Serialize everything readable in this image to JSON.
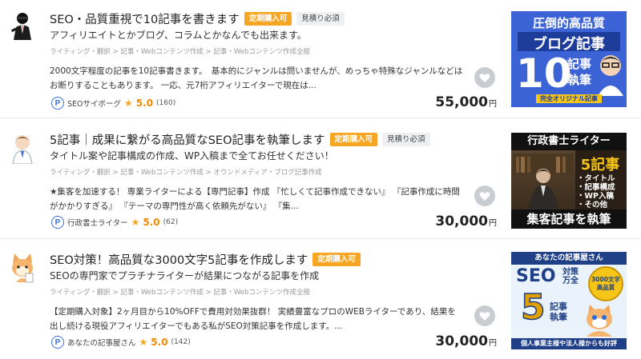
{
  "listings": [
    {
      "title": "SEO・品質重視で10記事を書きます",
      "badges": [
        "定期購入可",
        "見積り必須"
      ],
      "subtitle": "アフィリエイトとかブログ、コラムとかなんでも出来ます。",
      "breadcrumb": "ライティング・翻訳 > 記事・Webコンテンツ作成 > 記事・Webコンテンツ作成全般",
      "desc_line1": "2000文字程度の記事を10記事書きます。　基本的にジャンルは問いませんが、めっちゃ特殊なジャンルなどは",
      "desc_line2": "お断りすることもあります。 一応、元7桁アフィリエイターで現在は...",
      "seller": "SEOサイボーグ",
      "rating": "5.0",
      "reviews": "(160)",
      "price": "55,000",
      "yen": "円",
      "thumb": {
        "line1": "圧倒的高品質",
        "line2": "ブログ記事",
        "number": "10",
        "side1": "記事",
        "side2": "執筆",
        "footer": "完全オリジナル記事"
      }
    },
    {
      "title": "5記事｜成果に繋がる高品質なSEO記事を執筆します",
      "badges": [
        "定期購入可",
        "見積り必須"
      ],
      "subtitle": "タイトル案や記事構成の作成、WP入稿まで全てお任せください！",
      "breadcrumb": "ライティング・翻訳 > 記事・Webコンテンツ作成 > オウンドメディア・ブログ記事作成",
      "desc_line1": "★集客を加速する！ 専業ライターによる【専門記事】作成 『忙しくて記事作成できない』 『記事作成に時間",
      "desc_line2": "がかかりすぎる』 『テーマの専門性が高く依頼先がない』 『集...",
      "seller": "行政書士ライター",
      "rating": "5.0",
      "reviews": "(62)",
      "price": "30,000",
      "yen": "円",
      "thumb": {
        "header": "行政書士ライター",
        "big": "5記事",
        "items": [
          "・タイトル",
          "・記事構成",
          "・WP入稿",
          "・その他"
        ],
        "footer": "集客記事を執筆"
      }
    },
    {
      "title": "SEO対策！高品質な3000文字5記事を作成します",
      "badges": [
        "定期購入可"
      ],
      "subtitle": "SEOの専門家でプラチナライターが結果につながる記事を作成",
      "breadcrumb": "ライティング・翻訳 > 記事・Webコンテンツ作成 > 記事・Webコンテンツ作成全般",
      "desc_line1": "【定期購入対象】2ヶ月目から10%OFFで費用対効果抜群！ 実績豊富なプロのWEBライターであり、結果を",
      "desc_line2": "出し続ける現役アフィリエイターでもある私がSEO対策記事を作成します。...",
      "seller": "あなたの記事屋さん",
      "rating": "5.0",
      "reviews": "(142)",
      "price": "30,000",
      "yen": "円",
      "thumb": {
        "header": "あなたの記事屋さん",
        "seo": "SEO",
        "side": "対策",
        "side2": "万全",
        "seal": "3000文字\n高品質",
        "big": "5",
        "kiji": "記事",
        "shippitsu": "執筆",
        "footer": "個人事業主様や法人様からも好評"
      }
    }
  ],
  "colors": {
    "badge_orange": "#f6a623",
    "rating_orange": "#f08a00",
    "seller_blue": "#3a6fd8"
  },
  "icons": [
    "heart-icon",
    "seller-rank-icon",
    "star-icon"
  ]
}
